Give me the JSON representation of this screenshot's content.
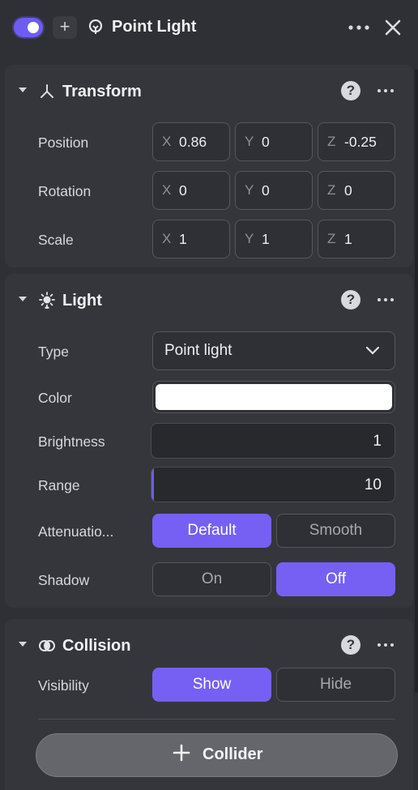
{
  "header": {
    "title": "Point Light",
    "add_label": "+",
    "enabled": true,
    "icons": {
      "toggle": "toggle-switch",
      "bulb": "bulb-icon",
      "more": "more-icon",
      "close": "close-icon"
    }
  },
  "transform": {
    "title": "Transform",
    "help": "?",
    "rows": [
      {
        "label": "Position",
        "x_axis": "X",
        "x": "0.86",
        "y_axis": "Y",
        "y": "0",
        "z_axis": "Z",
        "z": "-0.25"
      },
      {
        "label": "Rotation",
        "x_axis": "X",
        "x": "0",
        "y_axis": "Y",
        "y": "0",
        "z_axis": "Z",
        "z": "0"
      },
      {
        "label": "Scale",
        "x_axis": "X",
        "x": "1",
        "y_axis": "Y",
        "y": "1",
        "z_axis": "Z",
        "z": "1"
      }
    ]
  },
  "light": {
    "title": "Light",
    "help": "?",
    "type_label": "Type",
    "type_value": "Point light",
    "color_label": "Color",
    "color_value": "#ffffff",
    "brightness_label": "Brightness",
    "brightness_value": "1",
    "range_label": "Range",
    "range_value": "10",
    "range_fill_fraction": 0.01,
    "attenuation_label": "Attenuatio...",
    "attenuation_options": [
      "Default",
      "Smooth"
    ],
    "attenuation_selected": "Default",
    "shadow_label": "Shadow",
    "shadow_options": [
      "On",
      "Off"
    ],
    "shadow_selected": "Off"
  },
  "collision": {
    "title": "Collision",
    "help": "?",
    "visibility_label": "Visibility",
    "visibility_options": [
      "Show",
      "Hide"
    ],
    "visibility_selected": "Show",
    "add_collider_label": "Collider"
  },
  "colors": {
    "accent": "#7660f4",
    "panel": "#34363c",
    "background": "#2e3035"
  }
}
